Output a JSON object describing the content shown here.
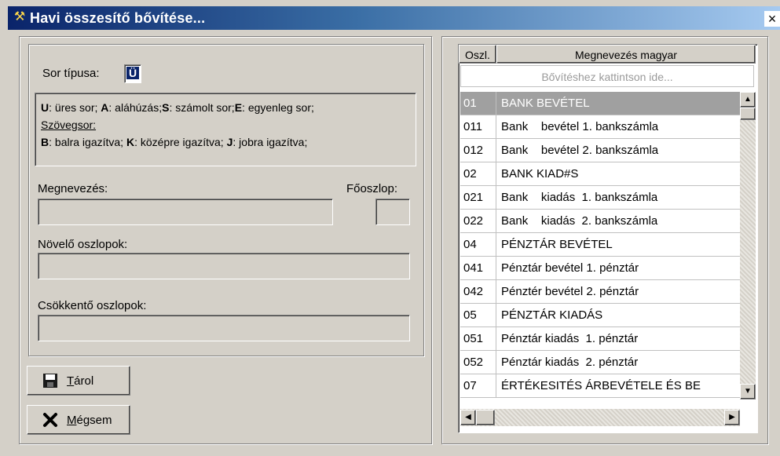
{
  "window": {
    "title": "Havi összesítő bővítése...",
    "close_label": "×"
  },
  "left": {
    "sor_tipusa_label": "Sor típusa:",
    "sor_tipusa_value": "Ü",
    "help": {
      "line1": [
        {
          "key": "U",
          "text": ": üres sor; "
        },
        {
          "key": "A",
          "text": ": aláhúzás;"
        },
        {
          "key": "S",
          "text": ": számolt sor;"
        },
        {
          "key": "E",
          "text": ": egyenleg sor;"
        }
      ],
      "szovegsor": "Szövegsor:",
      "line3": [
        {
          "key": "B",
          "text": ": balra igazítva; "
        },
        {
          "key": "K",
          "text": ": középre igazítva; "
        },
        {
          "key": "J",
          "text": ": jobra igazítva;"
        }
      ]
    },
    "megnevezes_label": "Megnevezés:",
    "foszlop_label": "Főoszlop:",
    "novelo_label": "Növelő oszlopok:",
    "csokkento_label": "Csökkentő oszlopok:"
  },
  "buttons": {
    "save_accel": "T",
    "save_rest": "árol",
    "cancel_accel": "M",
    "cancel_rest": "égsem"
  },
  "grid": {
    "columns": [
      "Oszl.",
      "Megnevezés magyar"
    ],
    "add_row_text": "Bővítéshez kattintson ide...",
    "rows": [
      {
        "code": "01",
        "name": "BANK BEVÉTEL",
        "selected": true
      },
      {
        "code": "011",
        "name": "Bank    bevétel 1. bankszámla"
      },
      {
        "code": "012",
        "name": "Bank    bevétel 2. bankszámla"
      },
      {
        "code": "02",
        "name": "BANK KIAD#S"
      },
      {
        "code": "021",
        "name": "Bank    kiadás  1. bankszámla"
      },
      {
        "code": "022",
        "name": "Bank    kiadás  2. bankszámla"
      },
      {
        "code": "04",
        "name": "PÉNZTÁR BEVÉTEL"
      },
      {
        "code": "041",
        "name": "Pénztár bevétel 1. pénztár"
      },
      {
        "code": "042",
        "name": "Pénztér bevétel 2. pénztár"
      },
      {
        "code": "05",
        "name": "PÉNZTÁR KIADÁS"
      },
      {
        "code": "051",
        "name": "Pénztár kiadás  1. pénztár"
      },
      {
        "code": "052",
        "name": "Pénztár kiadás  2. pénztár"
      },
      {
        "code": "07",
        "name": "ÉRTÉKESITÉS ÁRBEVÉTELE ÉS BE"
      }
    ]
  },
  "icons": {
    "app": "tools-icon",
    "save": "floppy-disk-icon",
    "cancel": "x-mark-icon",
    "scroll_up": "arrow-up-icon",
    "scroll_down": "arrow-down-icon",
    "scroll_left": "arrow-left-icon",
    "scroll_right": "arrow-right-icon"
  },
  "colors": {
    "title_start": "#0a246a",
    "title_end": "#a6caf0",
    "selected_row": "#a0a0a0",
    "face": "#d4d0c8"
  }
}
